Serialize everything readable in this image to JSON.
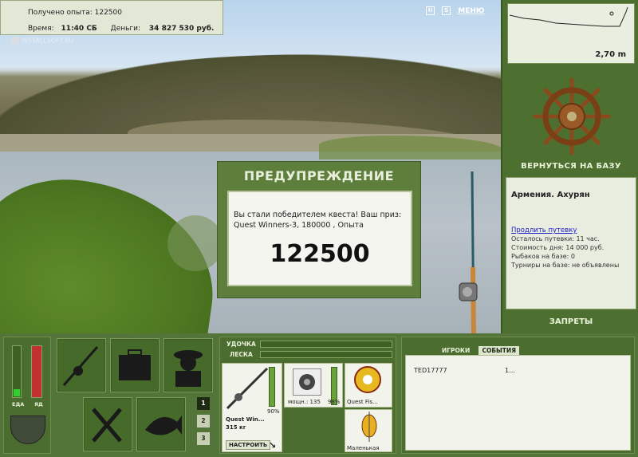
{
  "info": {
    "exp_label": "Получено опыта:",
    "exp_value": "122500",
    "time_label": "Время:",
    "time_value": "11:40 СБ",
    "money_label": "Деньги:",
    "money_value": "34 827 530 руб."
  },
  "watermark": "INSTALLSOFT.RU",
  "controls": {
    "pause": "II",
    "s": "S",
    "menu": "МЕНЮ"
  },
  "depth": {
    "value": "2,70 m"
  },
  "right": {
    "return_label": "ВЕРНУТЬСЯ НА БАЗУ",
    "location_title": "Армения. Ахурян",
    "extend_link": "Продлить путевку",
    "lines": [
      "Осталось путевки: 11 час.",
      "Стоимость дня: 14 000 руб.",
      "Рыбаков на базе: 0",
      "Турниры на базе: не объявлены"
    ],
    "bans_label": "ЗАПРЕТЫ"
  },
  "dialog": {
    "title": "ПРЕДУПРЕЖДЕНИЕ",
    "message": "Вы стали победителем квеста! Ваш приз: Quest Winners-3, 180000 , Опыта",
    "number": "122500"
  },
  "bottom": {
    "food_label": "ЕДА",
    "yd_label": "ЯД",
    "food_level": 0.15,
    "yd_level": 0.9,
    "rod_label": "УДОЧКА",
    "line_label": "ЛЕСКА",
    "rod_name": "Quest Win...",
    "rod_weight": "315 кг",
    "rod_percent": "90%",
    "setup_button": "НАСТРОИТЬ",
    "reel_text": "мощн.: 135",
    "reel_percent": "98%",
    "line_name": "Quest Fis...",
    "lure_name": "Маленькая",
    "tabs": [
      "ИГРОКИ",
      "СОБЫТИЯ"
    ],
    "players": [
      {
        "name": "TED17777",
        "value": "1..."
      }
    ],
    "pages": [
      "1",
      "2",
      "3"
    ]
  },
  "colors": {
    "panel": "#4d7030",
    "dialog": "#5e7e3c",
    "accent": "#e9efdc"
  }
}
